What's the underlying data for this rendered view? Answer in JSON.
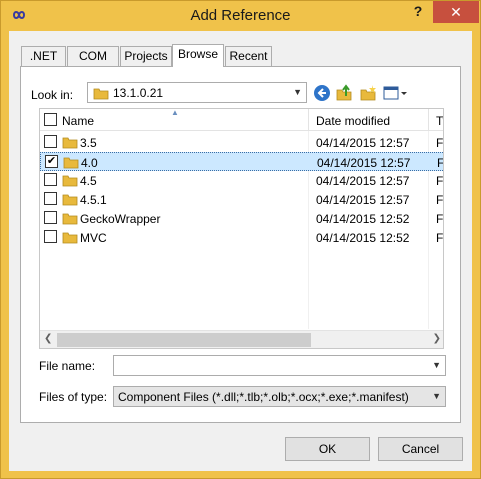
{
  "window": {
    "title": "Add Reference",
    "help": "?",
    "close": "✕"
  },
  "tabs": [
    {
      "label": ".NET"
    },
    {
      "label": "COM"
    },
    {
      "label": "Projects"
    },
    {
      "label": "Browse"
    },
    {
      "label": "Recent"
    }
  ],
  "active_tab": "Browse",
  "look_in": {
    "label": "Look in:",
    "value": "13.1.0.21"
  },
  "columns": {
    "name": "Name",
    "date": "Date modified",
    "type": "Ty"
  },
  "rows": [
    {
      "name": "3.5",
      "date": "04/14/2015 12:57",
      "type": "Fi",
      "checked": false,
      "selected": false
    },
    {
      "name": "4.0",
      "date": "04/14/2015 12:57",
      "type": "Fi",
      "checked": true,
      "selected": true
    },
    {
      "name": "4.5",
      "date": "04/14/2015 12:57",
      "type": "Fi",
      "checked": false,
      "selected": false
    },
    {
      "name": "4.5.1",
      "date": "04/14/2015 12:57",
      "type": "Fi",
      "checked": false,
      "selected": false
    },
    {
      "name": "GeckoWrapper",
      "date": "04/14/2015 12:52",
      "type": "Fi",
      "checked": false,
      "selected": false
    },
    {
      "name": "MVC",
      "date": "04/14/2015 12:52",
      "type": "Fi",
      "checked": false,
      "selected": false
    }
  ],
  "file_name": {
    "label": "File name:",
    "value": ""
  },
  "files_of_type": {
    "label": "Files of type:",
    "value": "Component Files (*.dll;*.tlb;*.olb;*.ocx;*.exe;*.manifest)"
  },
  "buttons": {
    "ok": "OK",
    "cancel": "Cancel"
  },
  "colors": {
    "titlebar": "#f0c24a",
    "close": "#c7503e",
    "selection": "#cce8ff",
    "folder": "#e8b93c"
  }
}
